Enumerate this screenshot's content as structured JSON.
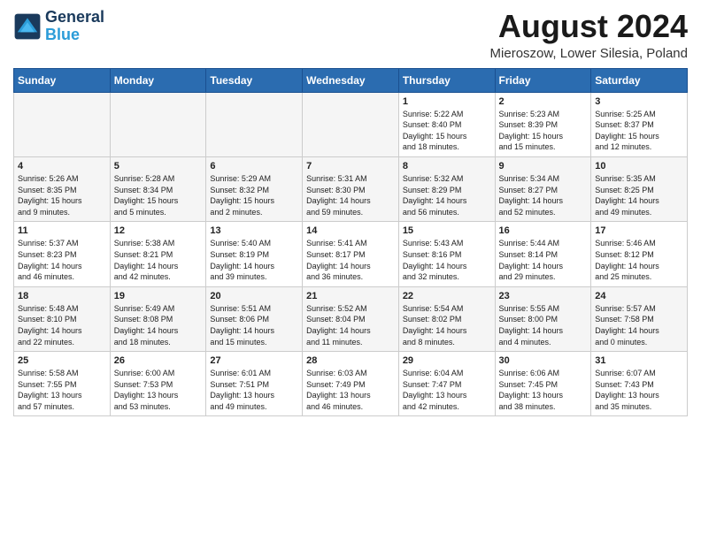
{
  "header": {
    "logo_line1": "General",
    "logo_line2": "Blue",
    "month_title": "August 2024",
    "location": "Mieroszow, Lower Silesia, Poland"
  },
  "days_of_week": [
    "Sunday",
    "Monday",
    "Tuesday",
    "Wednesday",
    "Thursday",
    "Friday",
    "Saturday"
  ],
  "weeks": [
    [
      {
        "day": "",
        "info": ""
      },
      {
        "day": "",
        "info": ""
      },
      {
        "day": "",
        "info": ""
      },
      {
        "day": "",
        "info": ""
      },
      {
        "day": "1",
        "info": "Sunrise: 5:22 AM\nSunset: 8:40 PM\nDaylight: 15 hours\nand 18 minutes."
      },
      {
        "day": "2",
        "info": "Sunrise: 5:23 AM\nSunset: 8:39 PM\nDaylight: 15 hours\nand 15 minutes."
      },
      {
        "day": "3",
        "info": "Sunrise: 5:25 AM\nSunset: 8:37 PM\nDaylight: 15 hours\nand 12 minutes."
      }
    ],
    [
      {
        "day": "4",
        "info": "Sunrise: 5:26 AM\nSunset: 8:35 PM\nDaylight: 15 hours\nand 9 minutes."
      },
      {
        "day": "5",
        "info": "Sunrise: 5:28 AM\nSunset: 8:34 PM\nDaylight: 15 hours\nand 5 minutes."
      },
      {
        "day": "6",
        "info": "Sunrise: 5:29 AM\nSunset: 8:32 PM\nDaylight: 15 hours\nand 2 minutes."
      },
      {
        "day": "7",
        "info": "Sunrise: 5:31 AM\nSunset: 8:30 PM\nDaylight: 14 hours\nand 59 minutes."
      },
      {
        "day": "8",
        "info": "Sunrise: 5:32 AM\nSunset: 8:29 PM\nDaylight: 14 hours\nand 56 minutes."
      },
      {
        "day": "9",
        "info": "Sunrise: 5:34 AM\nSunset: 8:27 PM\nDaylight: 14 hours\nand 52 minutes."
      },
      {
        "day": "10",
        "info": "Sunrise: 5:35 AM\nSunset: 8:25 PM\nDaylight: 14 hours\nand 49 minutes."
      }
    ],
    [
      {
        "day": "11",
        "info": "Sunrise: 5:37 AM\nSunset: 8:23 PM\nDaylight: 14 hours\nand 46 minutes."
      },
      {
        "day": "12",
        "info": "Sunrise: 5:38 AM\nSunset: 8:21 PM\nDaylight: 14 hours\nand 42 minutes."
      },
      {
        "day": "13",
        "info": "Sunrise: 5:40 AM\nSunset: 8:19 PM\nDaylight: 14 hours\nand 39 minutes."
      },
      {
        "day": "14",
        "info": "Sunrise: 5:41 AM\nSunset: 8:17 PM\nDaylight: 14 hours\nand 36 minutes."
      },
      {
        "day": "15",
        "info": "Sunrise: 5:43 AM\nSunset: 8:16 PM\nDaylight: 14 hours\nand 32 minutes."
      },
      {
        "day": "16",
        "info": "Sunrise: 5:44 AM\nSunset: 8:14 PM\nDaylight: 14 hours\nand 29 minutes."
      },
      {
        "day": "17",
        "info": "Sunrise: 5:46 AM\nSunset: 8:12 PM\nDaylight: 14 hours\nand 25 minutes."
      }
    ],
    [
      {
        "day": "18",
        "info": "Sunrise: 5:48 AM\nSunset: 8:10 PM\nDaylight: 14 hours\nand 22 minutes."
      },
      {
        "day": "19",
        "info": "Sunrise: 5:49 AM\nSunset: 8:08 PM\nDaylight: 14 hours\nand 18 minutes."
      },
      {
        "day": "20",
        "info": "Sunrise: 5:51 AM\nSunset: 8:06 PM\nDaylight: 14 hours\nand 15 minutes."
      },
      {
        "day": "21",
        "info": "Sunrise: 5:52 AM\nSunset: 8:04 PM\nDaylight: 14 hours\nand 11 minutes."
      },
      {
        "day": "22",
        "info": "Sunrise: 5:54 AM\nSunset: 8:02 PM\nDaylight: 14 hours\nand 8 minutes."
      },
      {
        "day": "23",
        "info": "Sunrise: 5:55 AM\nSunset: 8:00 PM\nDaylight: 14 hours\nand 4 minutes."
      },
      {
        "day": "24",
        "info": "Sunrise: 5:57 AM\nSunset: 7:58 PM\nDaylight: 14 hours\nand 0 minutes."
      }
    ],
    [
      {
        "day": "25",
        "info": "Sunrise: 5:58 AM\nSunset: 7:55 PM\nDaylight: 13 hours\nand 57 minutes."
      },
      {
        "day": "26",
        "info": "Sunrise: 6:00 AM\nSunset: 7:53 PM\nDaylight: 13 hours\nand 53 minutes."
      },
      {
        "day": "27",
        "info": "Sunrise: 6:01 AM\nSunset: 7:51 PM\nDaylight: 13 hours\nand 49 minutes."
      },
      {
        "day": "28",
        "info": "Sunrise: 6:03 AM\nSunset: 7:49 PM\nDaylight: 13 hours\nand 46 minutes."
      },
      {
        "day": "29",
        "info": "Sunrise: 6:04 AM\nSunset: 7:47 PM\nDaylight: 13 hours\nand 42 minutes."
      },
      {
        "day": "30",
        "info": "Sunrise: 6:06 AM\nSunset: 7:45 PM\nDaylight: 13 hours\nand 38 minutes."
      },
      {
        "day": "31",
        "info": "Sunrise: 6:07 AM\nSunset: 7:43 PM\nDaylight: 13 hours\nand 35 minutes."
      }
    ]
  ]
}
